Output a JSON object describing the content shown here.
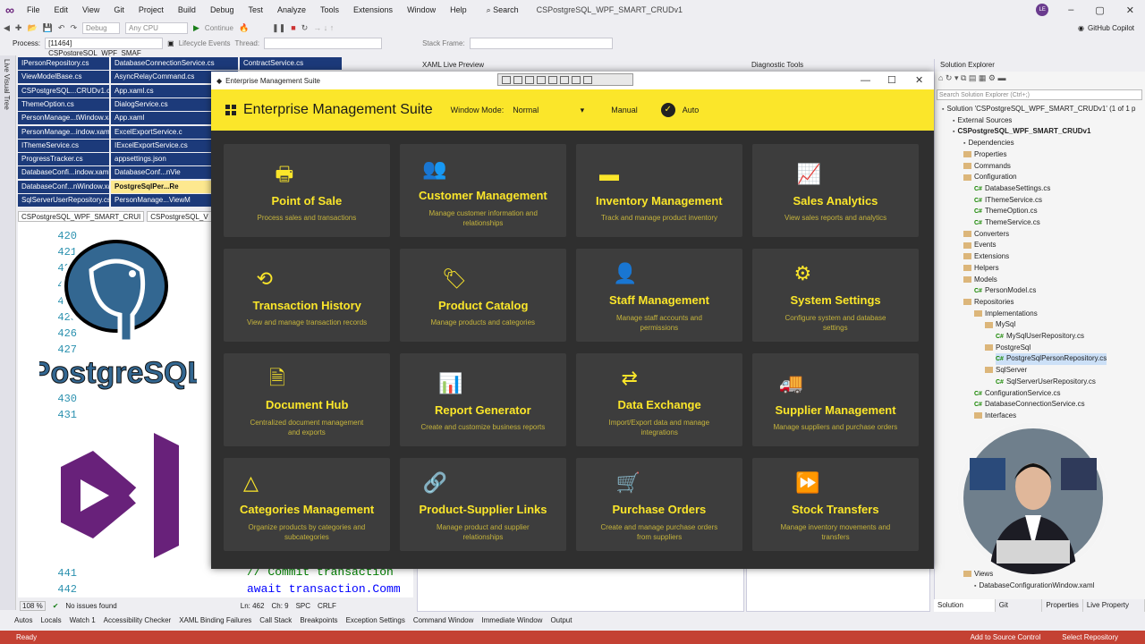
{
  "ide": {
    "menu": [
      "File",
      "Edit",
      "View",
      "Git",
      "Project",
      "Build",
      "Debug",
      "Test",
      "Analyze",
      "Tools",
      "Extensions",
      "Window",
      "Help"
    ],
    "search_label": "Search",
    "project_title": "CSPostgreSQL_WPF_SMART_CRUDv1",
    "user_initials": "LE",
    "copilot": "GitHub Copilot",
    "toolbar": {
      "config": "Debug",
      "platform": "Any CPU",
      "continue": "Continue"
    },
    "toolbar2": {
      "process_label": "Process:",
      "process_value": "[11464] CSPostgreSQL_WPF_SMAF",
      "lifecycle": "Lifecycle Events",
      "thread_label": "Thread:",
      "stack_label": "Stack Frame:"
    },
    "live_visual_tree": "Live Visual Tree",
    "file_tabs": [
      [
        "IPersonRepository.cs",
        "DatabaseConnectionService.cs",
        "ContractService.cs"
      ],
      [
        "ViewModelBase.cs",
        "AsyncRelayCommand.cs"
      ],
      [
        "CSPostgreSQL...CRUDv1.csproj",
        "App.xaml.cs"
      ],
      [
        "ThemeOption.cs",
        "DialogService.cs",
        "MainWi"
      ],
      [
        "PersonManage...tWindow.xaml",
        "App.xaml"
      ],
      [
        "PersonManage...indow.xaml.cs",
        "ExcelExportService.c"
      ],
      [
        "IThemeService.cs",
        "IExcelExportService.cs",
        "IS"
      ],
      [
        "ProgressTracker.cs",
        "appsettings.json",
        "Datab"
      ],
      [
        "DatabaseConfi...indow.xaml.cs",
        "DatabaseConf...nVie"
      ],
      [
        "DatabaseConf...nWindow.xaml",
        "PostgreSqlPer...Re"
      ],
      [
        "SqlServerUserRepository.cs",
        "PersonManage...ViewM"
      ]
    ],
    "editor_tabs": [
      "CSPostgreSQL_WPF_SMART_CRUI",
      "CSPostgreSQL_V"
    ],
    "line_numbers_top": [
      "420",
      "421",
      "422",
      "423",
      "424",
      "425",
      "426",
      "427",
      "428",
      "429",
      "430",
      "431",
      "432"
    ],
    "line_numbers_bottom": [
      "439",
      "440",
      "441",
      "442"
    ],
    "code_lines": [
      "// Commit transaction",
      "await transaction.Comm"
    ],
    "editor_status": {
      "zoom": "108 %",
      "issues": "No issues found",
      "ln": "Ln: 462",
      "ch": "Ch: 9",
      "spc": "SPC",
      "crlf": "CRLF"
    },
    "panels": {
      "xaml": "XAML Live Preview",
      "diag": "Diagnostic Tools",
      "sol": "Solution Explorer"
    },
    "sol_search": "Search Solution Explorer (Ctrl+;)",
    "sol_tree": [
      "Solution 'CSPostgreSQL_WPF_SMART_CRUDv1' (1 of 1 p",
      "External Sources",
      "CSPostgreSQL_WPF_SMART_CRUDv1",
      "Dependencies",
      "Properties",
      "Commands",
      "Configuration",
      "DatabaseSettings.cs",
      "IThemeService.cs",
      "ThemeOption.cs",
      "ThemeService.cs",
      "Converters",
      "Events",
      "Extensions",
      "Helpers",
      "Models",
      "PersonModel.cs",
      "Repositories",
      "Implementations",
      "MySql",
      "MySqlUserRepository.cs",
      "PostgreSql",
      "PostgreSqlPersonRepository.cs",
      "SqlServer",
      "SqlServerUserRepository.cs",
      "ConfigurationService.cs",
      "DatabaseConnectionService.cs",
      "Interfaces",
      "Views",
      "DatabaseConfigurationWindow.xaml"
    ],
    "sol_tabs": [
      "Solution Explorer",
      "Git Changes",
      "Properties",
      "Live Property E..."
    ],
    "bottom_tabs": [
      "Autos",
      "Locals",
      "Watch 1",
      "Accessibility Checker",
      "XAML Binding Failures",
      "Call Stack",
      "Breakpoints",
      "Exception Settings",
      "Command Window",
      "Immediate Window",
      "Output"
    ],
    "status": {
      "left": "Ready",
      "add_source": "Add to Source Control",
      "select_repo": "Select Repository"
    },
    "pg_logo_text": "PostgreSQL"
  },
  "app": {
    "window_title": "Enterprise Management Suite",
    "header_title": "Enterprise Management Suite",
    "window_mode_label": "Window Mode:",
    "window_mode_value": "Normal",
    "manual_label": "Manual",
    "auto_label": "Auto",
    "accent": "#fbe62a",
    "tiles": [
      {
        "icon": "cash-register-icon",
        "glyph": "🖶",
        "title": "Point of Sale",
        "desc": "Process sales and transactions"
      },
      {
        "icon": "users-icon",
        "glyph": "👥",
        "title": "Customer Management",
        "desc": "Manage customer information and|relationships"
      },
      {
        "icon": "archive-icon",
        "glyph": "▬",
        "title": "Inventory Management",
        "desc": "Track and manage product inventory"
      },
      {
        "icon": "chart-line-icon",
        "glyph": "📈",
        "title": "Sales Analytics",
        "desc": "View sales reports and analytics"
      },
      {
        "icon": "history-icon",
        "glyph": "⟲",
        "title": "Transaction History",
        "desc": "View and manage transaction records"
      },
      {
        "icon": "tags-icon",
        "glyph": "🏷",
        "title": "Product Catalog",
        "desc": "Manage products and categories"
      },
      {
        "icon": "user-gear-icon",
        "glyph": "👤",
        "title": "Staff Management",
        "desc": "Manage staff accounts and|permissions"
      },
      {
        "icon": "gear-icon",
        "glyph": "⚙",
        "title": "System Settings",
        "desc": "Configure system and database|settings"
      },
      {
        "icon": "document-icon",
        "glyph": "🗎",
        "title": "Document Hub",
        "desc": "Centralized document management|and exports"
      },
      {
        "icon": "report-icon",
        "glyph": "📊",
        "title": "Report Generator",
        "desc": "Create and customize business reports"
      },
      {
        "icon": "exchange-icon",
        "glyph": "⇄",
        "title": "Data Exchange",
        "desc": "Import/Export data and manage|integrations"
      },
      {
        "icon": "truck-icon",
        "glyph": "🚚",
        "title": "Supplier Management",
        "desc": "Manage suppliers and purchase orders"
      },
      {
        "icon": "shapes-icon",
        "glyph": "△",
        "title": "Categories Management",
        "desc": "Organize products by categories and|subcategories"
      },
      {
        "icon": "link-icon",
        "glyph": "🔗",
        "title": "Product-Supplier Links",
        "desc": "Manage product and supplier|relationships"
      },
      {
        "icon": "cart-icon",
        "glyph": "🛒",
        "title": "Purchase Orders",
        "desc": "Create and manage purchase orders|from suppliers"
      },
      {
        "icon": "forward-icon",
        "glyph": "⏩",
        "title": "Stock Transfers",
        "desc": "Manage inventory movements and|transfers"
      }
    ]
  }
}
